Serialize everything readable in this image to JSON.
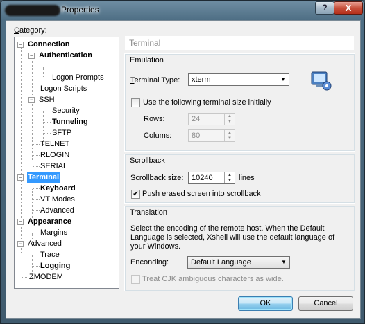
{
  "window": {
    "title": "Properties"
  },
  "category_label": "Category:",
  "tree": [
    {
      "label": "Connection",
      "bold": true
    },
    {
      "label": "Authentication",
      "bold": true
    },
    {
      "label": "Logon Prompts",
      "bold": false
    },
    {
      "label": "Logon Scripts",
      "bold": false
    },
    {
      "label": "SSH",
      "bold": false
    },
    {
      "label": "Security",
      "bold": false
    },
    {
      "label": "Tunneling",
      "bold": true
    },
    {
      "label": "SFTP",
      "bold": false
    },
    {
      "label": "TELNET",
      "bold": false
    },
    {
      "label": "RLOGIN",
      "bold": false
    },
    {
      "label": "SERIAL",
      "bold": false
    },
    {
      "label": "Terminal",
      "bold": true,
      "selected": true
    },
    {
      "label": "Keyboard",
      "bold": true
    },
    {
      "label": "VT Modes",
      "bold": false
    },
    {
      "label": "Advanced",
      "bold": false
    },
    {
      "label": "Appearance",
      "bold": true
    },
    {
      "label": "Margins",
      "bold": false
    },
    {
      "label": "Advanced",
      "bold": false
    },
    {
      "label": "Trace",
      "bold": false
    },
    {
      "label": "Logging",
      "bold": true
    },
    {
      "label": "ZMODEM",
      "bold": false
    }
  ],
  "page_title": "Terminal",
  "emulation": {
    "title": "Emulation",
    "terminal_type_label": "Terminal Type:",
    "terminal_type_value": "xterm",
    "use_size_label": "Use the following terminal size initially",
    "use_size_checked": false,
    "rows_label": "Rows:",
    "rows_value": "24",
    "columns_label": "Colums:",
    "columns_value": "80"
  },
  "scrollback": {
    "title": "Scrollback",
    "size_label": "Scrollback size:",
    "size_value": "10240",
    "unit": "lines",
    "push_label": "Push erased screen into scrollback",
    "push_checked": true
  },
  "translation": {
    "title": "Translation",
    "description": "Select the encoding of the remote host. When the Default Language is selected, Xshell will use the default language of your Windows.",
    "encoding_label": "Enconding:",
    "encoding_value": "Default Language",
    "cjk_label": "Treat CJK ambiguous characters as wide.",
    "cjk_checked": false
  },
  "buttons": {
    "ok": "OK",
    "cancel": "Cancel",
    "help": "?",
    "close": "X"
  }
}
